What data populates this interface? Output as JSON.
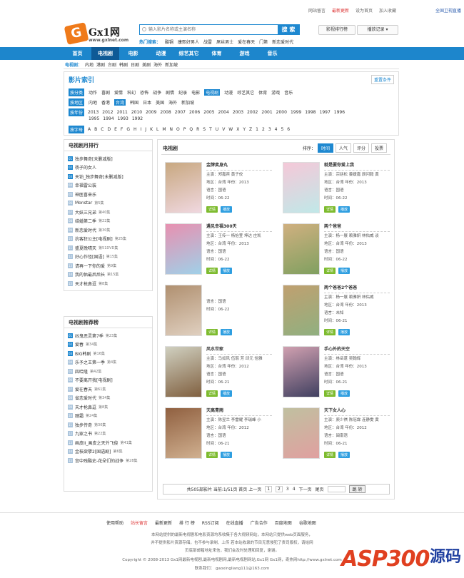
{
  "toplinks": [
    "网站留言",
    "最新更新",
    "设为首页",
    "加入收藏",
    "全国卫视直播"
  ],
  "logo": {
    "text": "Gx1网",
    "url": "www.gxlnet.com",
    "g": "G"
  },
  "search": {
    "placeholder": "输入影片名称或主演名称",
    "button": "搜 索",
    "hot_label": "热门搜索：",
    "hot": [
      "酷锅",
      "康熙好男人",
      "战雷",
      "屌丝男士",
      "爱在春天",
      "门第",
      "新恋爱时代"
    ]
  },
  "header_btns": {
    "rank": "影视排行榜",
    "history": "播放记录 ▾"
  },
  "nav": [
    "首页",
    "电视剧",
    "电影",
    "动漫",
    "综艺其它",
    "体育",
    "游戏",
    "音乐"
  ],
  "subnav": {
    "label": "电视剧：",
    "items": [
      "内地",
      "港剧",
      "台剧",
      "韩剧",
      "日剧",
      "美剧",
      "海外",
      "新加坡"
    ]
  },
  "index": {
    "title": "影片索引",
    "reset": "重置条件",
    "type": {
      "label": "按分类",
      "items": [
        "动作",
        "喜剧",
        "爱情",
        "科幻",
        "恐怖",
        "战争",
        "剧情",
        "纪录",
        "电影",
        "电视剧",
        "动漫",
        "综艺其它",
        "体育",
        "游戏",
        "音乐"
      ],
      "selected": "电视剧"
    },
    "area": {
      "label": "按地区",
      "items": [
        "内地",
        "香港",
        "台湾",
        "韩国",
        "日本",
        "美国",
        "海外",
        "新加坡"
      ],
      "selected": "台湾"
    },
    "year": {
      "label": "按年份",
      "row1": [
        "2013",
        "2012",
        "2011",
        "2010",
        "2009",
        "2008",
        "2007",
        "2006",
        "2005",
        "2004",
        "2003",
        "2002",
        "2001",
        "2000",
        "1999",
        "1998",
        "1997",
        "1996"
      ],
      "row2": [
        "1995",
        "1994",
        "1993",
        "1992"
      ]
    },
    "letter": {
      "label": "按字母",
      "items": [
        "A",
        "B",
        "C",
        "D",
        "E",
        "F",
        "G",
        "H",
        "I",
        "J",
        "K",
        "L",
        "M",
        "N",
        "O",
        "P",
        "Q",
        "R",
        "S",
        "T",
        "U",
        "V",
        "W",
        "X",
        "Y",
        "Z",
        "1",
        "2",
        "3",
        "4",
        "5",
        "6"
      ]
    }
  },
  "monthly": {
    "title": "电视剧月排行",
    "items": [
      {
        "n": "01",
        "t": "独步舞奇[未删减版]",
        "s": ""
      },
      {
        "n": "02",
        "t": "杨子的女人",
        "s": ""
      },
      {
        "n": "03",
        "t": "天铂_独步舞奇[未删减版]",
        "s": ""
      },
      {
        "n": "04",
        "t": "幸福雷公装",
        "s": ""
      },
      {
        "n": "05",
        "t": "神医喜来乐",
        "s": ""
      },
      {
        "n": "06",
        "t": "Monstar",
        "s": "第5集"
      },
      {
        "n": "07",
        "t": "大妖三兄弟",
        "s": "第40集"
      },
      {
        "n": "08",
        "t": "结婚第二季",
        "s": "第22集"
      },
      {
        "n": "09",
        "t": "新恋爱时代",
        "s": "第30集"
      },
      {
        "n": "10",
        "t": "抗客狂公主[电视剧]",
        "s": "第25集"
      },
      {
        "n": "11",
        "t": "盛夏晚晴天",
        "s": "第51DVD集"
      },
      {
        "n": "12",
        "t": "好心作怪[国语]",
        "s": "第15集"
      },
      {
        "n": "13",
        "t": "请再一下你的爱",
        "s": "第9集"
      },
      {
        "n": "14",
        "t": "我的佑最后后长",
        "s": "第15集"
      },
      {
        "n": "15",
        "t": "天才枪鼻逗",
        "s": "第8集"
      }
    ]
  },
  "recommend": {
    "title": "电视剧推荐榜",
    "items": [
      {
        "n": "01",
        "t": "凶鬼恶灵第7季",
        "s": "第23集"
      },
      {
        "n": "02",
        "t": "爱春",
        "s": "第34集"
      },
      {
        "n": "03",
        "t": "BIG韩剧",
        "s": "第16集"
      },
      {
        "n": "04",
        "t": "乐予之王第一季",
        "s": "第4集"
      },
      {
        "n": "05",
        "t": "四哈隆",
        "s": "第42集"
      },
      {
        "n": "06",
        "t": "不要离开我[电视剧]",
        "s": ""
      },
      {
        "n": "07",
        "t": "爱在春天",
        "s": "第61集"
      },
      {
        "n": "08",
        "t": "省恋爱时代",
        "s": "第34集"
      },
      {
        "n": "09",
        "t": "天才枪鼻逗",
        "s": "第8集"
      },
      {
        "n": "10",
        "t": "踏霜",
        "s": "第24集"
      },
      {
        "n": "11",
        "t": "独步传奇",
        "s": "第30集"
      },
      {
        "n": "12",
        "t": "九家之书",
        "s": "第22集"
      },
      {
        "n": "13",
        "t": "画皮II_画皮之天外飞俊",
        "s": "第41集"
      },
      {
        "n": "14",
        "t": "金枝欲孽2[国语剧]",
        "s": "第6集"
      },
      {
        "n": "15",
        "t": "宫中残酷史-花朵们的战争",
        "s": "第28集"
      }
    ]
  },
  "main": {
    "title": "电视剧",
    "sort_label": "排序：",
    "sorts": [
      "时间",
      "人气",
      "评分",
      "投票"
    ]
  },
  "labels": {
    "star": "主演：",
    "area": "地区：",
    "lang": "语言：",
    "time": "时间：",
    "detail": "详情",
    "play": "播放"
  },
  "cards": [
    {
      "title": "金牌卖身丸",
      "star": "郑嘉宾 黄子佼",
      "area": "台湾",
      "year": "年份：2013",
      "lang": "国语",
      "time": "06-22",
      "c1": "#c8a880",
      "c2": "#f0d8e0"
    },
    {
      "title": "就是要你爱上我",
      "star": "宗廷松 姜媛嘉 颜闪毅 黄",
      "area": "台湾",
      "year": "年份：2013",
      "lang": "国语",
      "time": "06-22",
      "c1": "#f5c8d8",
      "c2": "#c0e8e8"
    },
    {
      "title": "遇见幸福300天",
      "star": "王传一 杨怡萱 坤达 庄凯",
      "area": "台湾",
      "year": "年份：2013",
      "lang": "国语",
      "time": "06-22",
      "c1": "#e890b0",
      "c2": "#a0d0e8"
    },
    {
      "title": "两个爸爸",
      "star": "杨一展 赖雅妍 林佑威 谈",
      "area": "台湾",
      "year": "年份：2013",
      "lang": "国语",
      "time": "06-22",
      "c1": "#d0b080",
      "c2": "#80a060"
    },
    {
      "title": "",
      "star": "",
      "area": "",
      "year": "",
      "lang": "国语",
      "time": "06-22",
      "c1": "#b09070",
      "c2": "#e0d0c0"
    },
    {
      "title": "两个爸爸2个爸爸",
      "star": "杨一展 赖雅妍 林佑威",
      "area": "台湾",
      "year": "年份：2013",
      "lang": "未知",
      "time": "06-21",
      "c1": "#c0a070",
      "c2": "#90b080"
    },
    {
      "title": "风水世家",
      "star": "马如风 伍珉 芳 邱元 恰雅",
      "area": "台湾",
      "year": "年份：2012",
      "lang": "国语",
      "time": "06-21",
      "c1": "#d0d0c0",
      "c2": "#806040"
    },
    {
      "title": "手心外的天空",
      "star": "林岳蓬 吴翰辉",
      "area": "台湾",
      "year": "年份：2013",
      "lang": "国语",
      "time": "06-21",
      "c1": "#d0a0b0",
      "c2": "#404060"
    },
    {
      "title": "天高青雨",
      "star": "陈昱兰 李雷耀 李瑞峰 小",
      "area": "台湾",
      "year": "年份：2012",
      "lang": "国语",
      "time": "06-21",
      "c1": "#906040",
      "c2": "#d0b090"
    },
    {
      "title": "天下女人心",
      "star": "庾少祺 陈冠霖 连静雯 黄",
      "area": "台湾",
      "year": "年份：2012",
      "lang": "闽南语",
      "time": "06-21",
      "c1": "#c0c0a0",
      "c2": "#e0a0a0"
    }
  ],
  "pager": {
    "info": "共505部影片 当前:1/51页 首页 上一页",
    "pages": [
      "1",
      "2",
      "3",
      "4"
    ],
    "next": "下一页",
    "last": "尾页",
    "go": "跳 转"
  },
  "footer": {
    "links": [
      "使用帮助",
      "站长留言",
      "最新更新",
      "排 行 榜",
      "RSS订阅",
      "在线直播",
      "广告合作",
      "百度地图",
      "谷歌地图"
    ],
    "line1": "本网站提供的最新电视剧和电影资源均系收集于各大视频网站，本网站只提供web页面服务，",
    "line2": "并不提供影片资源存储，也不参与录制、上传 若本站收录的节目无意侵犯了贵司版权，请给网",
    "line3": "页底部邮箱地址来信，我们会及时处理和回复，谢谢。",
    "copyright": "Copyright © 2008-2013 Gx1网最新电视剧,最新电视剧网,最新电视剧网站,Gx1网 Gx1网，奇热网http://www.gxlnet.com",
    "contact": "联系我们：  gaoxingliang111@163.com"
  },
  "watermark": {
    "text": "ASP300",
    "cn": "源码"
  }
}
